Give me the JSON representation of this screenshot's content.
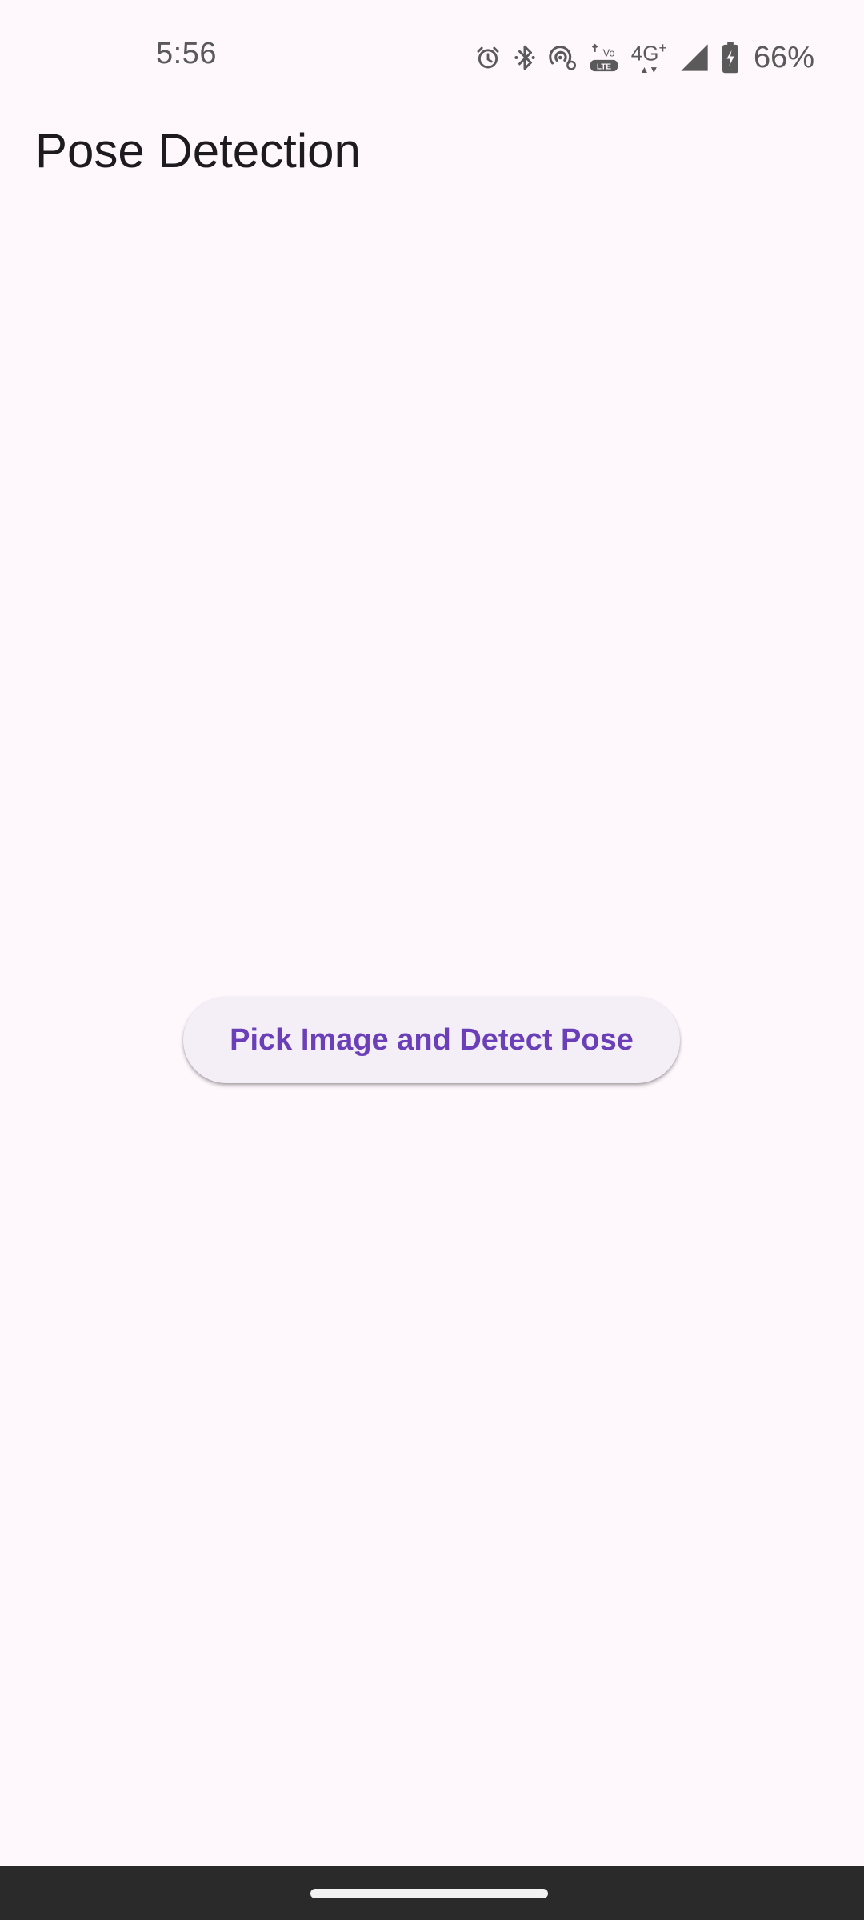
{
  "status_bar": {
    "time": "5:56",
    "network_type": "4G",
    "network_plus": "+",
    "volte": "LTE",
    "battery_percent": "66%",
    "icons": [
      "alarm-icon",
      "bluetooth-icon",
      "hotspot-icon",
      "volte-icon",
      "signal-icon",
      "battery-charging-icon"
    ]
  },
  "app_bar": {
    "title": "Pose Detection"
  },
  "main": {
    "button_label": "Pick Image and Detect Pose"
  },
  "colors": {
    "background": "#fef7fc",
    "button_background": "#f4eff7",
    "button_text": "#6a3fb8",
    "nav_bar": "#2a2a2a"
  }
}
